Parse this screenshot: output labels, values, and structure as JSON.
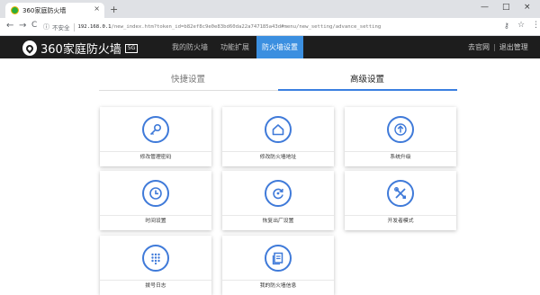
{
  "browser": {
    "tab_title": "360家庭防火墙",
    "tab_close": "×",
    "new_tab": "+",
    "win_min": "—",
    "win_max": "□",
    "win_close": "×",
    "back": "←",
    "forward": "→",
    "reload": "C",
    "info": "ⓘ",
    "insecure_label": "不安全",
    "url_host": "192.168.0.1",
    "url_path": "/new_index.htm?token_id=b82ef8c9e0e83bd60da22a747185a43d#menu/new_setting/advance_setting"
  },
  "header": {
    "brand": "360家庭防火墙",
    "badge": "5G",
    "menu": [
      {
        "label": "我的防火墙"
      },
      {
        "label": "功能扩展"
      },
      {
        "label": "防火墙设置"
      }
    ],
    "link_site": "去官网",
    "link_sep": "|",
    "link_logout": "退出管理"
  },
  "subtabs": {
    "quick": "快捷设置",
    "advanced": "高级设置"
  },
  "cards": [
    {
      "label": "修改管理密码",
      "icon": "key-icon"
    },
    {
      "label": "修改防火墙地址",
      "icon": "home-icon"
    },
    {
      "label": "系统升级",
      "icon": "upgrade-arrow-icon"
    },
    {
      "label": "时间设置",
      "icon": "clock-icon"
    },
    {
      "label": "恢复出厂设置",
      "icon": "restore-icon"
    },
    {
      "label": "开发者模式",
      "icon": "tools-icon"
    },
    {
      "label": "拨号日志",
      "icon": "dialpad-icon"
    },
    {
      "label": "我的防火墙信息",
      "icon": "document-icon"
    }
  ],
  "colors": {
    "accent": "#3b8fe0",
    "header_bg": "#1d1d1d",
    "icon_blue": "#3f7ad9"
  }
}
